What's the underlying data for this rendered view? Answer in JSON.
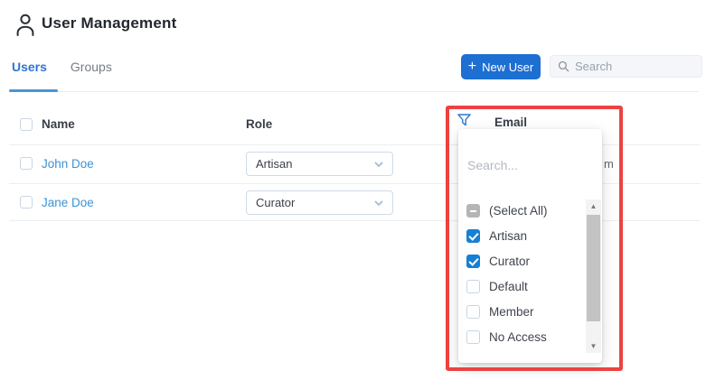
{
  "page": {
    "title": "User Management"
  },
  "tabs": [
    {
      "label": "Users",
      "active": true
    },
    {
      "label": "Groups",
      "active": false
    }
  ],
  "toolbar": {
    "new_user_label": "New User",
    "plus_glyph": "+",
    "search_placeholder": "Search"
  },
  "table": {
    "headers": {
      "name": "Name",
      "role": "Role",
      "email": "Email"
    },
    "rows": [
      {
        "name": "John Doe",
        "role": "Artisan",
        "email_visible_fragment": "m"
      },
      {
        "name": "Jane Doe",
        "role": "Curator"
      }
    ]
  },
  "filter_popup": {
    "column": "Email",
    "search_placeholder": "Search...",
    "options": [
      {
        "label": "(Select All)",
        "state": "indeterminate"
      },
      {
        "label": "Artisan",
        "state": "checked"
      },
      {
        "label": "Curator",
        "state": "checked"
      },
      {
        "label": "Default",
        "state": "unchecked"
      },
      {
        "label": "Member",
        "state": "unchecked"
      },
      {
        "label": "No Access",
        "state": "unchecked"
      }
    ],
    "scrollbar": {
      "up_glyph": "▲",
      "down_glyph": "▼"
    }
  },
  "annotation": {
    "highlight_color": "#ec4242"
  },
  "colors": {
    "accent_blue": "#1d6fd2",
    "link_blue": "#3b93d6",
    "checkbox_checked": "#1680d4",
    "tab_active": "#2d76d2"
  }
}
